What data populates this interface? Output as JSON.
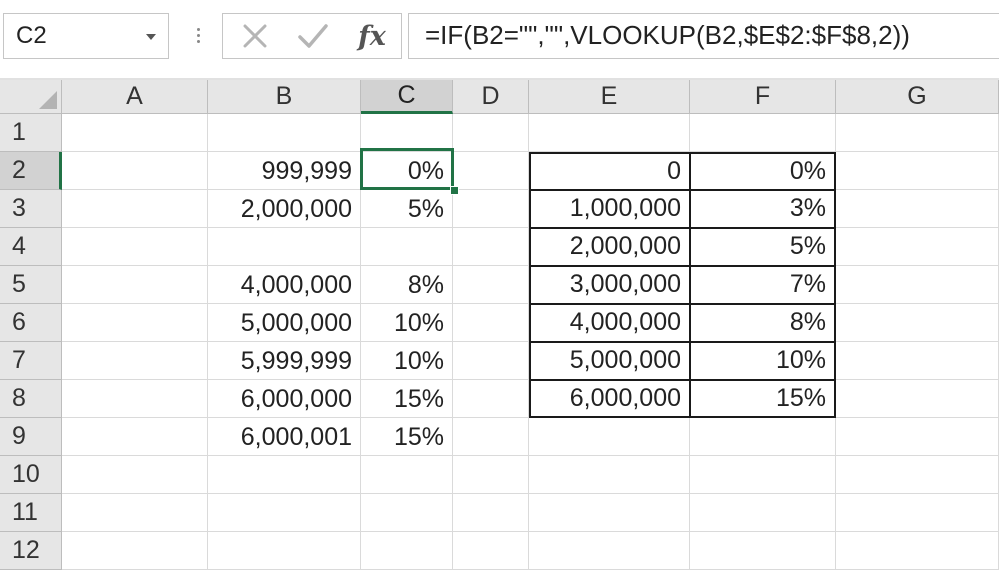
{
  "name_box": {
    "value": "C2"
  },
  "formula_bar": {
    "fx_label": "fx",
    "formula": "=IF(B2=\"\",\"\",VLOOKUP(B2,$E$2:$F$8,2))"
  },
  "columns": [
    "A",
    "B",
    "C",
    "D",
    "E",
    "F",
    "G"
  ],
  "rows": [
    "1",
    "2",
    "3",
    "4",
    "5",
    "6",
    "7",
    "8",
    "9",
    "10",
    "11",
    "12"
  ],
  "sheet": {
    "B": [
      "",
      "999,999",
      "2,000,000",
      "",
      "4,000,000",
      "5,000,000",
      "5,999,999",
      "6,000,000",
      "6,000,001",
      "",
      "",
      ""
    ],
    "C": [
      "",
      "0%",
      "5%",
      "",
      "8%",
      "10%",
      "10%",
      "15%",
      "15%",
      "",
      "",
      ""
    ],
    "E": [
      "",
      "0",
      "1,000,000",
      "2,000,000",
      "3,000,000",
      "4,000,000",
      "5,000,000",
      "6,000,000",
      "",
      "",
      "",
      ""
    ],
    "F": [
      "",
      "0%",
      "3%",
      "5%",
      "7%",
      "8%",
      "10%",
      "15%",
      "",
      "",
      "",
      ""
    ]
  },
  "selection": {
    "active_cell": "C2"
  },
  "colors": {
    "accent": "#217346",
    "header_bg": "#e6e6e6",
    "grid_line": "#dadada"
  },
  "icons": [
    "cancel-icon",
    "enter-check-icon",
    "insert-function-icon",
    "dropdown-arrow-icon",
    "more-options-icon",
    "select-all-icon"
  ]
}
